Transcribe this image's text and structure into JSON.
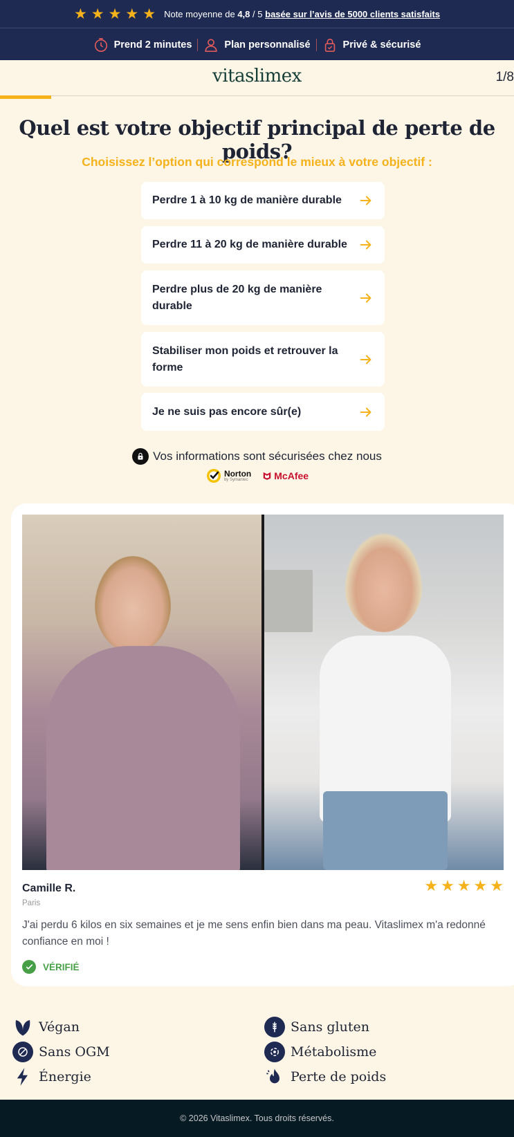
{
  "topbar": {
    "rating_prefix": "Note moyenne de",
    "rating_value": "4,8",
    "rating_max": "/ 5",
    "rating_link": "basée sur l’avis de 5000 clients satisfaits",
    "features": [
      "Prend 2 minutes",
      "Plan personnalisé",
      "Privé & sécurisé"
    ]
  },
  "header": {
    "logo": "vitaslimex",
    "step": "1/8",
    "progress_fraction": 0.125
  },
  "question": {
    "title": "Quel est votre objectif principal de perte de poids?",
    "subtitle": "Choisissez l’option qui correspond le mieux à votre objectif :",
    "options": [
      "Perdre 1 à 10 kg de manière durable",
      "Perdre 11 à 20 kg de manière durable",
      "Perdre plus de 20 kg de manière durable",
      "Stabiliser mon poids et retrouver la forme",
      "Je ne suis pas encore sûr(e)"
    ]
  },
  "security": {
    "text": "Vos informations sont sécurisées chez nous",
    "norton": "Norton",
    "norton_sub": "by Symantec",
    "mcafee": "McAfee"
  },
  "testimonial": {
    "name": "Camille R.",
    "city": "Paris",
    "rating": 5,
    "text": "J'ai perdu 6 kilos en six semaines et je me sens enfin bien dans ma peau. Vitaslimex m'a redonné confiance en moi !",
    "verified": "VÉRIFIÉ"
  },
  "benefits": [
    "Végan",
    "Sans gluten",
    "Sans OGM",
    "Métabolisme",
    "Énergie",
    "Perte de poids"
  ],
  "footer": {
    "copyright": "© 2026 Vitaslimex. Tous droits réservés."
  },
  "colors": {
    "navy": "#1e2a52",
    "accent": "#f5b21b",
    "cream": "#fdf5e6",
    "green": "#47a047"
  }
}
